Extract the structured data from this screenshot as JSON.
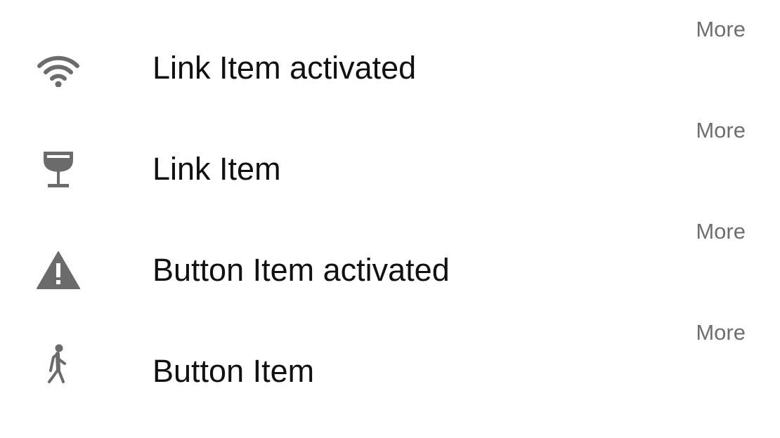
{
  "list": {
    "items": [
      {
        "label": "Link Item activated",
        "more": "More",
        "icon": "wifi-icon"
      },
      {
        "label": "Link Item",
        "more": "More",
        "icon": "wine-glass-icon"
      },
      {
        "label": "Button Item activated",
        "more": "More",
        "icon": "warning-icon"
      },
      {
        "label": "Button Item",
        "more": "More",
        "icon": "walking-person-icon"
      }
    ],
    "icon_color": "#6b6b6b",
    "label_color": "#111111",
    "more_color": "#6e6e6e"
  }
}
